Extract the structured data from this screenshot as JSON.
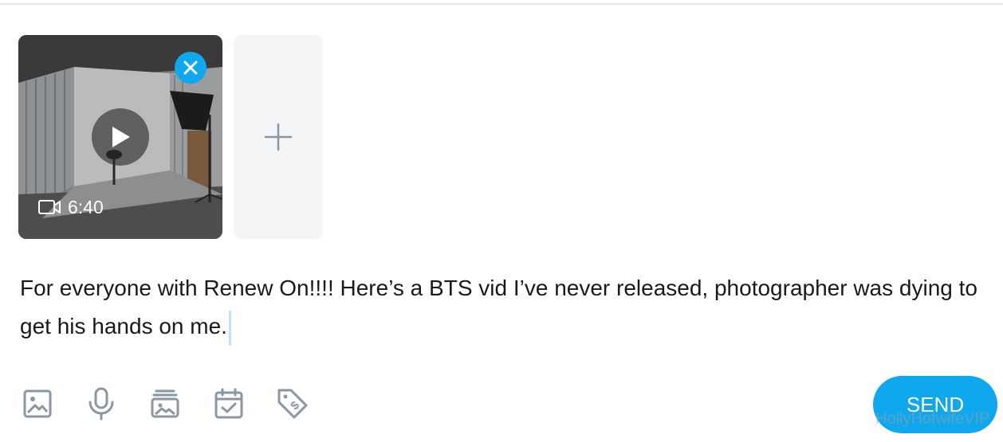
{
  "media": {
    "duration": "6:40",
    "icons": {
      "remove": "close-icon",
      "play": "play-icon",
      "video": "video-camera-icon",
      "add": "plus-icon"
    }
  },
  "post": {
    "text": "For everyone with Renew On!!!! Here’s a BTS vid I’ve never released, photographer was dying to get his hands on me."
  },
  "toolbar": {
    "icons": [
      "image-icon",
      "microphone-icon",
      "vault-icon",
      "calendar-check-icon",
      "price-tag-icon"
    ]
  },
  "send_label": "SEND",
  "watermark": "HollyHotwifeVIP",
  "colors": {
    "accent": "#0fa7ee",
    "icon": "#8a96a3",
    "text": "#1a1a1a"
  }
}
